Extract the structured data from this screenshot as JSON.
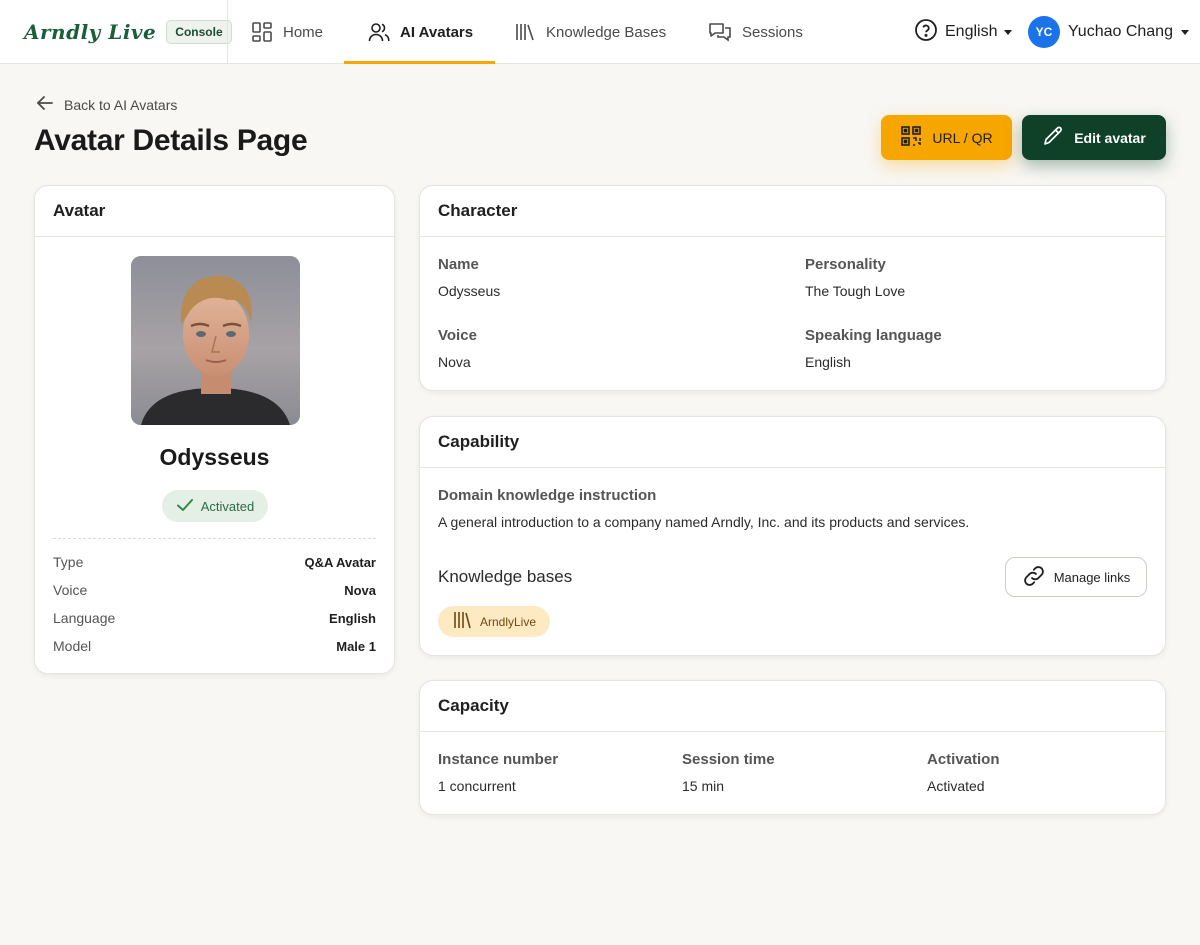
{
  "brand": {
    "logo": "Arndly Live",
    "badge": "Console"
  },
  "nav": {
    "tabs": [
      {
        "label": "Home",
        "icon": "grid-icon"
      },
      {
        "label": "AI Avatars",
        "icon": "users-icon",
        "active": true
      },
      {
        "label": "Knowledge Bases",
        "icon": "library-icon"
      },
      {
        "label": "Sessions",
        "icon": "chat-icon"
      }
    ],
    "language": "English",
    "user": {
      "initials": "YC",
      "name": "Yuchao Chang"
    }
  },
  "header": {
    "back_label": "Back to AI Avatars",
    "title": "Avatar Details Page",
    "url_button": "URL / QR",
    "edit_button": "Edit avatar"
  },
  "avatar_card": {
    "title": "Avatar",
    "name": "Odysseus",
    "status": "Activated",
    "details": [
      {
        "key": "Type",
        "value": "Q&A Avatar"
      },
      {
        "key": "Voice",
        "value": "Nova"
      },
      {
        "key": "Language",
        "value": "English"
      },
      {
        "key": "Model",
        "value": "Male 1"
      }
    ]
  },
  "character": {
    "title": "Character",
    "name_label": "Name",
    "name_value": "Odysseus",
    "personality_label": "Personality",
    "personality_value": "The Tough Love",
    "voice_label": "Voice",
    "voice_value": "Nova",
    "speaking_label": "Speaking language",
    "speaking_value": "English"
  },
  "capability": {
    "title": "Capability",
    "instruction_label": "Domain knowledge instruction",
    "instruction_value": "A general introduction to a company named Arndly, Inc. and its products and services.",
    "kb_title": "Knowledge bases",
    "manage_button": "Manage links",
    "kb_chip": "ArndlyLive"
  },
  "capacity": {
    "title": "Capacity",
    "instance_label": "Instance number",
    "instance_value": "1 concurrent",
    "session_label": "Session time",
    "session_value": "15 min",
    "activation_label": "Activation",
    "activation_value": "Activated"
  },
  "colors": {
    "accent_orange": "#f7a600",
    "brand_green": "#0f4128",
    "user_blue": "#1a73e8",
    "status_green": "#2f6b45"
  }
}
